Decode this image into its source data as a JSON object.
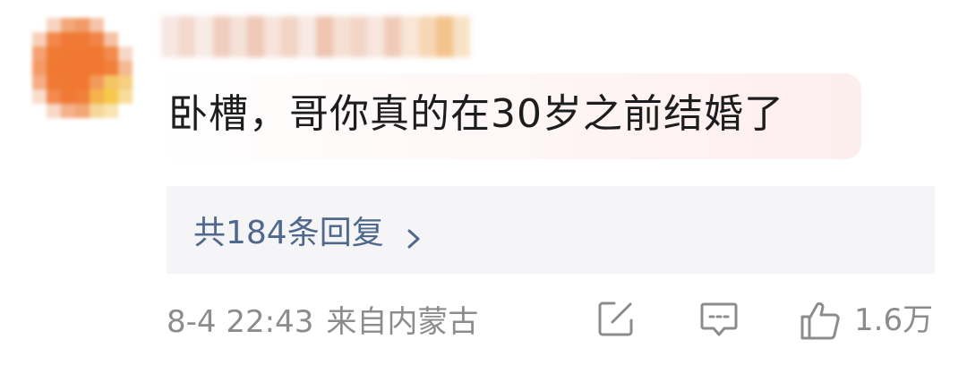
{
  "comment": {
    "text": "卧槽，哥你真的在30岁之前结婚了"
  },
  "replies": {
    "label": "共184条回复"
  },
  "meta": {
    "time": "8-4 22:43",
    "location": "来自内蒙古"
  },
  "actions": {
    "like_count": "1.6万"
  },
  "colors": {
    "link": "#50688b",
    "meta": "#8c8c8c",
    "reply_bg": "#f5f5f7"
  },
  "icons": [
    "edit-icon",
    "comment-icon",
    "thumbs-up-icon",
    "chevron-right-icon"
  ]
}
